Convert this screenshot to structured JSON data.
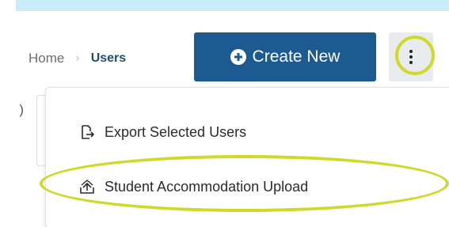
{
  "breadcrumb": {
    "home": "Home",
    "separator": "›",
    "current": "Users"
  },
  "header": {
    "create_label": "Create New",
    "create_icon": "plus-circle-icon",
    "more_icon": "vertical-ellipsis-icon"
  },
  "background": {
    "field_fragment": ")"
  },
  "menu": {
    "items": [
      {
        "label": "Export Selected Users",
        "icon": "export-icon"
      },
      {
        "label": "Student Accommodation Upload",
        "icon": "upload-icon"
      }
    ]
  },
  "colors": {
    "accent": "#1c5a91",
    "highlight": "#cfd92a",
    "top_strip": "#c9ecfb"
  }
}
